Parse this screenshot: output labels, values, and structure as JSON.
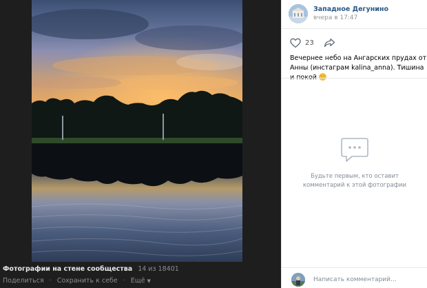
{
  "viewer": {
    "album_title": "Фотографии на стене сообщества",
    "counter": "14 из 18401",
    "actions": {
      "share": "Поделиться",
      "save": "Сохранить к себе",
      "more": "Ещё"
    }
  },
  "post": {
    "author_name": "Западное Дегунино",
    "time": "вчера в 17:47",
    "likes": "23",
    "caption": "Вечернее небо на Ангарских прудах от Анны (инстаграм kalina_anna). Тишина и покой"
  },
  "comments": {
    "empty_text": "Будьте первым, кто оставит комментарий к этой фотографии",
    "input_placeholder": "Написать комментарий..."
  },
  "icons": {
    "like": "heart-icon",
    "share": "share-arrow-icon",
    "empty": "comment-bubble-icon",
    "more": "chevron-down-icon",
    "emoji": "relieved-face-emoji"
  },
  "colors": {
    "link": "#2a5885",
    "viewer_bg": "#1e1e1e",
    "muted": "#818c99"
  }
}
